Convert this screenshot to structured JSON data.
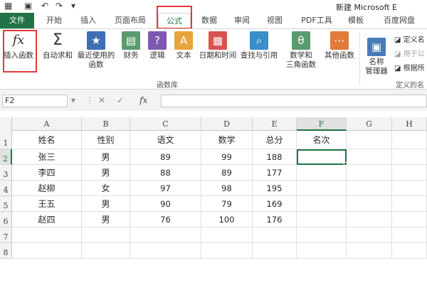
{
  "window": {
    "title": "新建 Microsoft E"
  },
  "qat": {
    "save_icon": "save-icon",
    "undo_icon": "undo-icon",
    "redo_icon": "redo-icon"
  },
  "tabs": [
    {
      "label": "文件"
    },
    {
      "label": "开始"
    },
    {
      "label": "插入"
    },
    {
      "label": "页面布局"
    },
    {
      "label": "公式"
    },
    {
      "label": "数据"
    },
    {
      "label": "审阅"
    },
    {
      "label": "视图"
    },
    {
      "label": "PDF工具"
    },
    {
      "label": "模板"
    },
    {
      "label": "百度网盘"
    }
  ],
  "ribbon": {
    "insert_function": {
      "label": "插入函数",
      "glyph": "fx"
    },
    "autosum": {
      "label": "自动求和",
      "glyph": "Σ"
    },
    "recent": {
      "label1": "最近使用的",
      "label2": "函数",
      "glyph": "★"
    },
    "financial": {
      "label": "财务",
      "glyph": "▤"
    },
    "logical": {
      "label": "逻辑",
      "glyph": "?"
    },
    "text": {
      "label": "文本",
      "glyph": "A"
    },
    "datetime": {
      "label": "日期和时间",
      "glyph": "▦"
    },
    "lookup": {
      "label": "查找与引用",
      "glyph": "⌕"
    },
    "math": {
      "label1": "数学和",
      "label2": "三角函数",
      "glyph": "θ"
    },
    "more": {
      "label": "其他函数",
      "glyph": "⋯"
    },
    "group_label": "函数库",
    "name_manager": {
      "label1": "名称",
      "label2": "管理器",
      "glyph": "▣"
    },
    "define_name": "定义名",
    "use_in_formula": "用于公",
    "create_from_selection": "根据所",
    "group_label2": "定义的名"
  },
  "formula_bar": {
    "name_box": "F2",
    "cancel": "✕",
    "enter": "✓",
    "fx": "fx",
    "formula": ""
  },
  "sheet": {
    "columns": [
      "A",
      "B",
      "C",
      "D",
      "E",
      "F",
      "G",
      "H"
    ],
    "rows": [
      "1",
      "2",
      "3",
      "4",
      "5",
      "6",
      "7",
      "8"
    ],
    "header_row": [
      "姓名",
      "性别",
      "语文",
      "数学",
      "总分",
      "名次"
    ],
    "data": [
      [
        "张三",
        "男",
        "89",
        "99",
        "188"
      ],
      [
        "李四",
        "男",
        "88",
        "89",
        "177"
      ],
      [
        "赵柳",
        "女",
        "97",
        "98",
        "195"
      ],
      [
        "王五",
        "男",
        "90",
        "79",
        "169"
      ],
      [
        "赵四",
        "男",
        "76",
        "100",
        "176"
      ]
    ],
    "active_cell": "F2"
  },
  "colors": {
    "accent": "#217346",
    "highlight": "#e23b3b"
  }
}
